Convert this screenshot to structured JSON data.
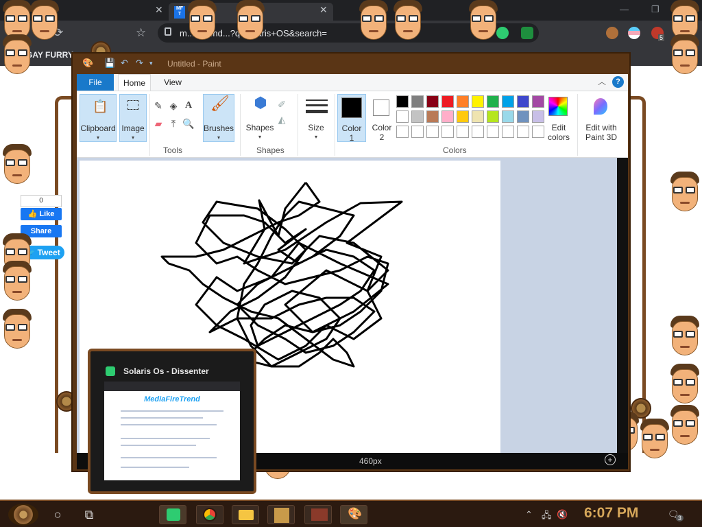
{
  "browser": {
    "tabs": [
      {
        "label": ""
      },
      {
        "label": ""
      }
    ],
    "favicon_text": "MF T",
    "address_visible": "m...retrend...?q=solaris+OS&search=",
    "bookmark_label": "GAY FURRY",
    "badges": {
      "extension_count": "5"
    }
  },
  "social": {
    "like_count": "0",
    "like_label": "Like",
    "share_label": "Share",
    "tweet_label": "Tweet"
  },
  "paint": {
    "title": "Untitled - Paint",
    "tabs": {
      "file": "File",
      "home": "Home",
      "view": "View"
    },
    "groups": {
      "clipboard": "Clipboard",
      "image": "Image",
      "tools": "Tools",
      "brushes": "Brushes",
      "shapes": "Shapes",
      "shapes_group": "Shapes",
      "size": "Size",
      "color1": "Color",
      "color1_num": "1",
      "color2": "Color",
      "color2_num": "2",
      "edit_colors": "Edit",
      "edit_colors2": "colors",
      "paint3d": "Edit with",
      "paint3d2": "Paint 3D",
      "colors": "Colors"
    },
    "palette_row1": [
      "#000000",
      "#7f7f7f",
      "#880015",
      "#ed1c24",
      "#ff7f27",
      "#fff200",
      "#22b14c",
      "#00a2e8",
      "#3f48cc",
      "#a349a4"
    ],
    "palette_row2": [
      "#ffffff",
      "#c3c3c3",
      "#b97a57",
      "#ffaec9",
      "#ffc90e",
      "#efe4b0",
      "#b5e61d",
      "#99d9ea",
      "#7092be",
      "#c8bfe7"
    ],
    "palette_row3": [
      "#ffffff",
      "#ffffff",
      "#ffffff",
      "#ffffff",
      "#ffffff",
      "#ffffff",
      "#ffffff",
      "#ffffff",
      "#ffffff",
      "#ffffff"
    ],
    "status_size": "460px"
  },
  "preview": {
    "title": "Solaris Os - Dissenter",
    "site_name": "MediaFireTrend"
  },
  "taskbar": {
    "time": "6:07 PM",
    "notification_count": "3"
  },
  "icons": [
    "start-icon",
    "cortana-icon",
    "task-view-icon",
    "dissenter-icon",
    "chrome-icon",
    "folder-icon",
    "paint-icon",
    "reload-icon",
    "bookmark-star-icon",
    "help-icon"
  ]
}
